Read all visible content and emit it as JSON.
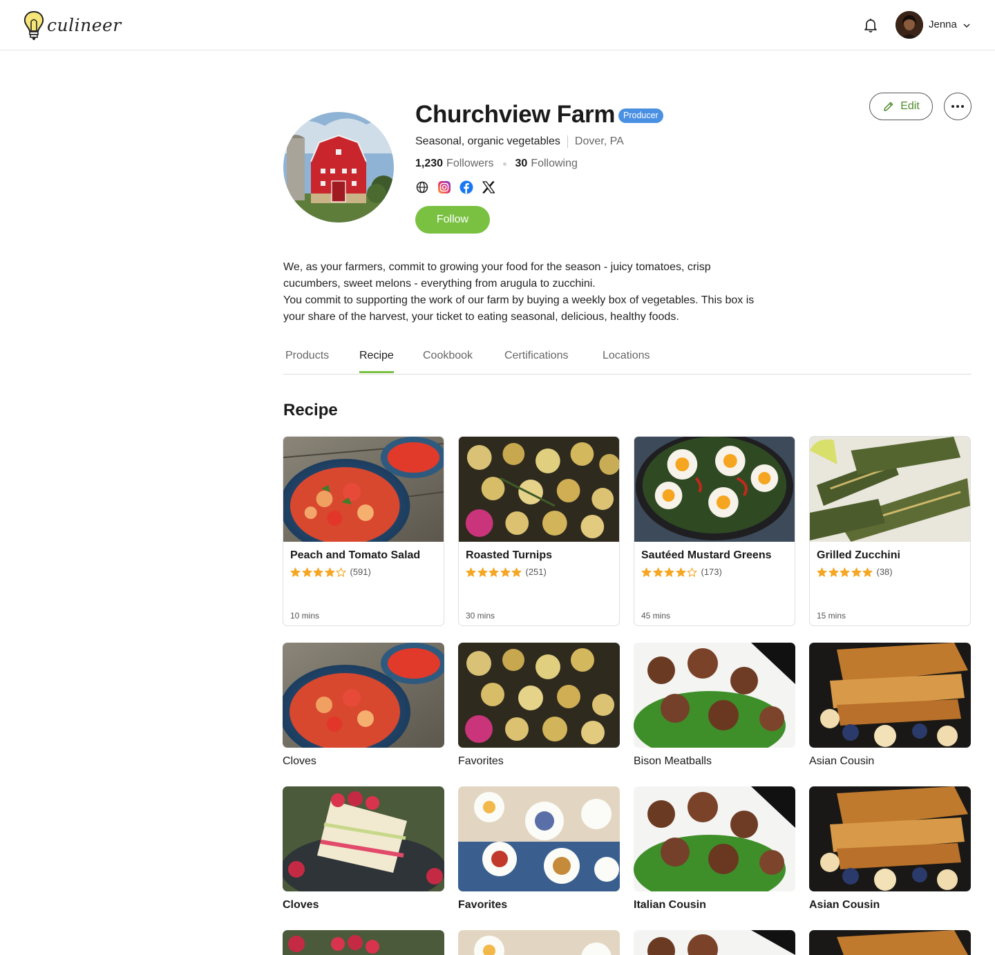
{
  "header": {
    "logo_text": "culineer",
    "user_name": "Jenna"
  },
  "profile": {
    "name": "Churchview Farm",
    "badge": "Producer",
    "tagline": "Seasonal, organic vegetables",
    "location": "Dover, PA",
    "followers_count": "1,230",
    "followers_label": "Followers",
    "following_count": "30",
    "following_label": "Following",
    "follow_label": "Follow",
    "edit_label": "Edit",
    "socials": [
      "globe-icon",
      "instagram-icon",
      "facebook-icon",
      "x-icon"
    ],
    "bio": [
      "We, as your farmers, commit to growing your food for the season - juicy tomatoes, crisp cucumbers, sweet melons - everything from arugula to zucchini.",
      "You commit to supporting the work of our farm by buying a weekly box of vegetables. This box is your share of the harvest, your ticket to eating seasonal, delicious, healthy foods."
    ]
  },
  "tabs": [
    {
      "label": "Products"
    },
    {
      "label": "Recipe"
    },
    {
      "label": "Cookbook"
    },
    {
      "label": "Certifications"
    },
    {
      "label": "Locations"
    }
  ],
  "section_title": "Recipe",
  "recipes": [
    {
      "title": "Peach and Tomato Salad",
      "rating": 4,
      "reviews": "(591)",
      "time": "10 mins"
    },
    {
      "title": "Roasted Turnips",
      "rating": 5,
      "reviews": "(251)",
      "time": "30 mins"
    },
    {
      "title": "Sautéed Mustard Greens",
      "rating": 4,
      "reviews": "(173)",
      "time": "45 mins"
    },
    {
      "title": "Grilled Zucchini",
      "rating": 5,
      "reviews": "(38)",
      "time": "15 mins"
    }
  ],
  "collections_row1": [
    {
      "label": "Cloves"
    },
    {
      "label": "Favorites"
    },
    {
      "label": "Bison Meatballs"
    },
    {
      "label": "Asian Cousin"
    }
  ],
  "collections_row2": [
    {
      "label": "Cloves"
    },
    {
      "label": "Favorites"
    },
    {
      "label": "Italian Cousin"
    },
    {
      "label": "Asian Cousin"
    }
  ],
  "colors": {
    "accent_green": "#7ac142",
    "badge_blue": "#4a90e2",
    "star": "#f5a623"
  }
}
